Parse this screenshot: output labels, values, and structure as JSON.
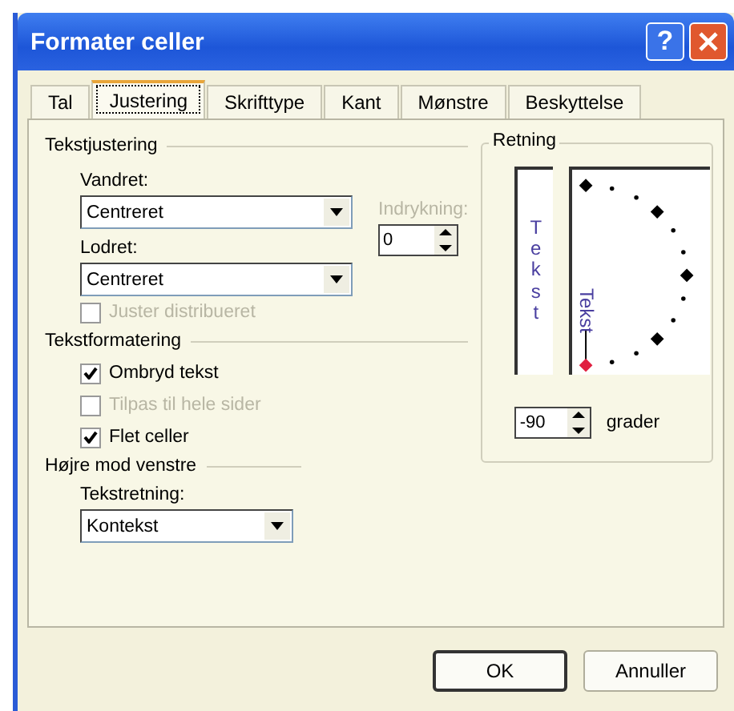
{
  "window": {
    "title": "Formater celler",
    "help_label": "?"
  },
  "tabs": [
    {
      "label": "Tal",
      "selected": false
    },
    {
      "label": "Justering",
      "selected": true
    },
    {
      "label": "Skrifttype",
      "selected": false
    },
    {
      "label": "Kant",
      "selected": false
    },
    {
      "label": "Mønstre",
      "selected": false
    },
    {
      "label": "Beskyttelse",
      "selected": false
    }
  ],
  "alignment": {
    "heading": "Tekstjustering",
    "horizontal": {
      "label": "Vandret:",
      "value": "Centreret"
    },
    "vertical": {
      "label": "Lodret:",
      "value": "Centreret"
    },
    "indent": {
      "label": "Indrykning:",
      "value": "0",
      "disabled": true
    },
    "distributed": {
      "label": "Juster distribueret",
      "checked": false,
      "disabled": true
    }
  },
  "formatting": {
    "heading": "Tekstformatering",
    "options": [
      {
        "label": "Ombryd tekst",
        "checked": true,
        "disabled": false
      },
      {
        "label": "Tilpas til hele sider",
        "checked": false,
        "disabled": true
      },
      {
        "label": "Flet celler",
        "checked": true,
        "disabled": false
      }
    ]
  },
  "rtl": {
    "heading": "Højre mod venstre",
    "direction": {
      "label": "Tekstretning:",
      "value": "Kontekst"
    }
  },
  "orientation": {
    "heading": "Retning",
    "vertical_text": "Tekst",
    "dial_text": "Tekst",
    "degrees": "-90",
    "unit": "grader"
  },
  "buttons": [
    {
      "label": "OK",
      "default": true
    },
    {
      "label": "Annuller",
      "default": false
    }
  ]
}
